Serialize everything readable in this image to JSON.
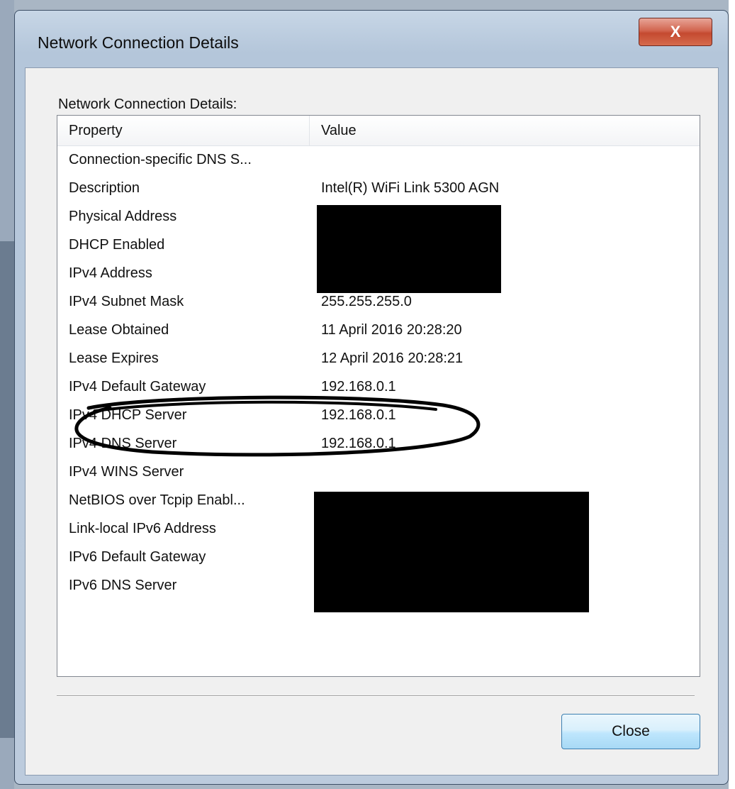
{
  "window": {
    "title": "Network Connection Details",
    "close_glyph": "X"
  },
  "group_label": "Network Connection Details:",
  "listview": {
    "columns": [
      "Property",
      "Value"
    ],
    "rows": [
      {
        "property": "Connection-specific DNS S...",
        "value": ""
      },
      {
        "property": "Description",
        "value": "Intel(R) WiFi Link 5300 AGN"
      },
      {
        "property": "Physical Address",
        "value": ""
      },
      {
        "property": "DHCP Enabled",
        "value": ""
      },
      {
        "property": "IPv4 Address",
        "value": ""
      },
      {
        "property": "IPv4 Subnet Mask",
        "value": "255.255.255.0"
      },
      {
        "property": "Lease Obtained",
        "value": "11 April 2016 20:28:20"
      },
      {
        "property": "Lease Expires",
        "value": "12 April 2016 20:28:21"
      },
      {
        "property": "IPv4 Default Gateway",
        "value": "192.168.0.1"
      },
      {
        "property": "IPv4 DHCP Server",
        "value": "192.168.0.1"
      },
      {
        "property": "IPv4 DNS Server",
        "value": "192.168.0.1"
      },
      {
        "property": "IPv4 WINS Server",
        "value": ""
      },
      {
        "property": "NetBIOS over Tcpip Enabl...",
        "value": ""
      },
      {
        "property": "Link-local IPv6 Address",
        "value": ""
      },
      {
        "property": "IPv6 Default Gateway",
        "value": ""
      },
      {
        "property": "IPv6 DNS Server",
        "value": ""
      }
    ]
  },
  "buttons": {
    "close_label": "Close"
  },
  "colors": {
    "redaction": "#000000",
    "annotation_ink": "#000000",
    "close_accent": "#c44a30"
  }
}
